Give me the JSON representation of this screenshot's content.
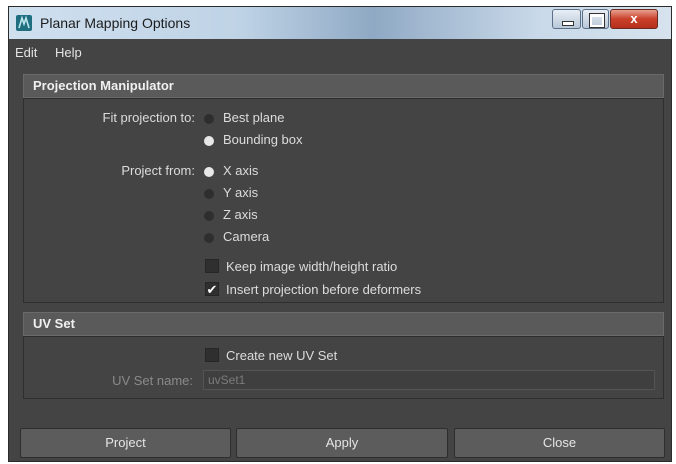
{
  "window": {
    "title": "Planar Mapping Options"
  },
  "titlebar": {
    "close_label": "x"
  },
  "menu": {
    "items": [
      "Edit",
      "Help"
    ]
  },
  "projection": {
    "header": "Projection Manipulator",
    "fit_label": "Fit projection to:",
    "fit_options": [
      {
        "label": "Best plane",
        "selected": false
      },
      {
        "label": "Bounding box",
        "selected": true
      }
    ],
    "project_label": "Project from:",
    "project_options": [
      {
        "label": "X axis",
        "selected": true
      },
      {
        "label": "Y axis",
        "selected": false
      },
      {
        "label": "Z axis",
        "selected": false
      },
      {
        "label": "Camera",
        "selected": false
      }
    ],
    "keep_ratio": {
      "label": "Keep image width/height ratio",
      "checked": false
    },
    "insert_projection": {
      "label": "Insert projection before deformers",
      "checked": true,
      "check_glyph": "✔"
    }
  },
  "uvset": {
    "header": "UV Set",
    "create_new": {
      "label": "Create new UV Set",
      "checked": false
    },
    "name_label": "UV Set name:",
    "name_value": "uvSet1"
  },
  "buttons": {
    "project": "Project",
    "apply": "Apply",
    "close": "Close"
  },
  "colors": {
    "window_bg": "#444444",
    "section_header_bg": "#5a5a5a",
    "button_bg": "#5c5c5c",
    "close_button": "#c9402a"
  }
}
